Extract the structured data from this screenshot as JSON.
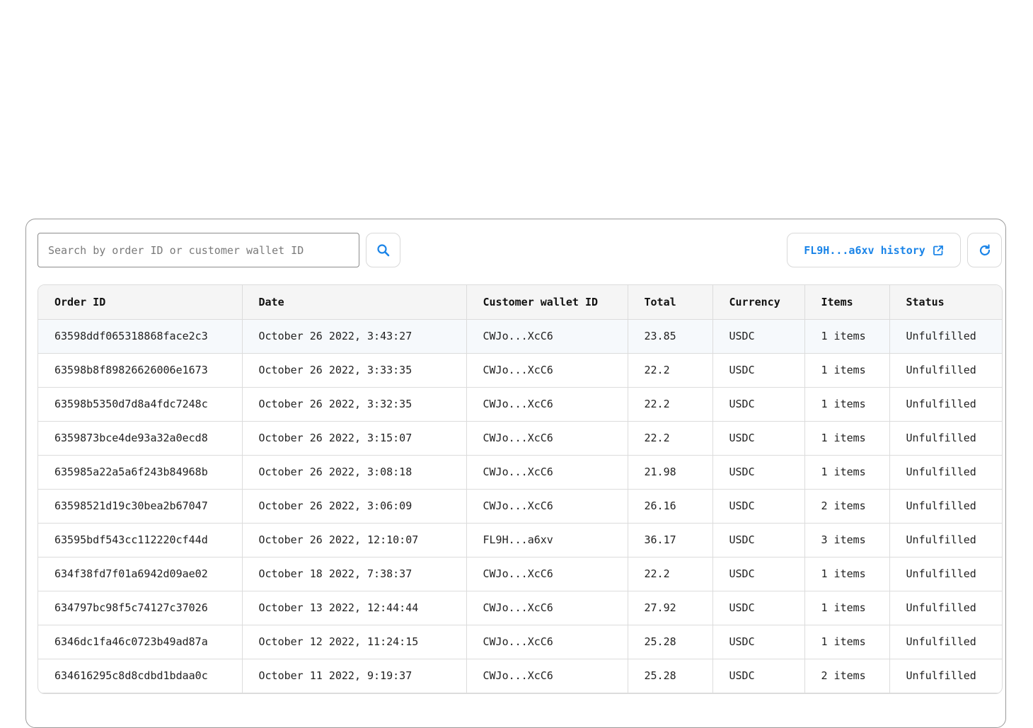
{
  "toolbar": {
    "search_placeholder": "Search by order ID or customer wallet ID",
    "search_value": "",
    "history_label": "FL9H...a6xv history",
    "accent_color": "#1a84e8"
  },
  "table": {
    "columns": [
      "Order ID",
      "Date",
      "Customer wallet ID",
      "Total",
      "Currency",
      "Items",
      "Status"
    ],
    "rows": [
      [
        "63598ddf065318868face2c3",
        "October 26 2022, 3:43:27",
        "CWJo...XcC6",
        "23.85",
        "USDC",
        "1 items",
        "Unfulfilled"
      ],
      [
        "63598b8f89826626006e1673",
        "October 26 2022, 3:33:35",
        "CWJo...XcC6",
        "22.2",
        "USDC",
        "1 items",
        "Unfulfilled"
      ],
      [
        "63598b5350d7d8a4fdc7248c",
        "October 26 2022, 3:32:35",
        "CWJo...XcC6",
        "22.2",
        "USDC",
        "1 items",
        "Unfulfilled"
      ],
      [
        "6359873bce4de93a32a0ecd8",
        "October 26 2022, 3:15:07",
        "CWJo...XcC6",
        "22.2",
        "USDC",
        "1 items",
        "Unfulfilled"
      ],
      [
        "635985a22a5a6f243b84968b",
        "October 26 2022, 3:08:18",
        "CWJo...XcC6",
        "21.98",
        "USDC",
        "1 items",
        "Unfulfilled"
      ],
      [
        "63598521d19c30bea2b67047",
        "October 26 2022, 3:06:09",
        "CWJo...XcC6",
        "26.16",
        "USDC",
        "2 items",
        "Unfulfilled"
      ],
      [
        "63595bdf543cc112220cf44d",
        "October 26 2022, 12:10:07",
        "FL9H...a6xv",
        "36.17",
        "USDC",
        "3 items",
        "Unfulfilled"
      ],
      [
        "634f38fd7f01a6942d09ae02",
        "October 18 2022, 7:38:37",
        "CWJo...XcC6",
        "22.2",
        "USDC",
        "1 items",
        "Unfulfilled"
      ],
      [
        "634797bc98f5c74127c37026",
        "October 13 2022, 12:44:44",
        "CWJo...XcC6",
        "27.92",
        "USDC",
        "1 items",
        "Unfulfilled"
      ],
      [
        "6346dc1fa46c0723b49ad87a",
        "October 12 2022, 11:24:15",
        "CWJo...XcC6",
        "25.28",
        "USDC",
        "1 items",
        "Unfulfilled"
      ],
      [
        "634616295c8d8cdbd1bdaa0c",
        "October 11 2022, 9:19:37",
        "CWJo...XcC6",
        "25.28",
        "USDC",
        "2 items",
        "Unfulfilled"
      ]
    ]
  }
}
